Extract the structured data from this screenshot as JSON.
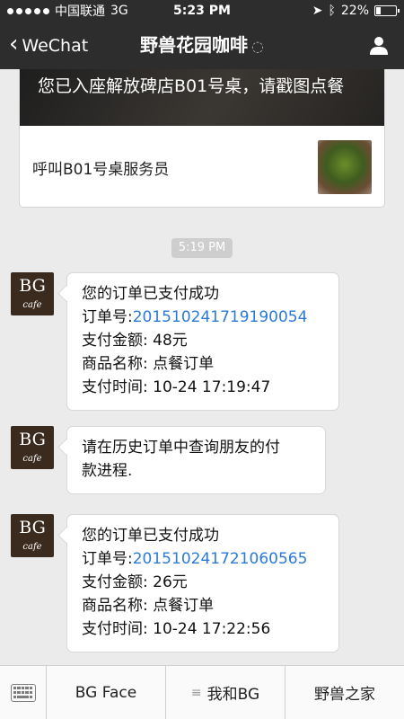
{
  "status_bar": {
    "carrier": "中国联通",
    "network": "3G",
    "time": "5:23 PM",
    "battery": "22%",
    "battery_level": 0.22
  },
  "nav": {
    "back_label": "WeChat",
    "title": "野兽花园咖啡"
  },
  "card": {
    "cover_text": "您已入座解放碑店B01号桌，请戳图点餐",
    "action_label": "呼叫B01号桌服务员"
  },
  "timestamp": "5:19 PM",
  "avatar": {
    "logo_top": "BG",
    "logo_bottom": "cafe"
  },
  "messages": [
    {
      "title": "您的订单已支付成功",
      "order_label": "订单号:",
      "order_no": "201510241719190054",
      "amount": "支付金额: 48元",
      "product": "商品名称: 点餐订单",
      "pay_time": "支付时间: 10-24 17:19:47"
    },
    {
      "line1": "请在历史订单中查询朋友的付",
      "line2": "款进程."
    },
    {
      "title": "您的订单已支付成功",
      "order_label": "订单号:",
      "order_no": "201510241721060565",
      "amount": "支付金额: 26元",
      "product": "商品名称: 点餐订单",
      "pay_time": "支付时间: 10-24 17:22:56"
    }
  ],
  "bottom_menu": [
    {
      "label": "BG Face"
    },
    {
      "label": "我和BG"
    },
    {
      "label": "野兽之家"
    }
  ],
  "colors": {
    "link": "#2a7ad8",
    "topbar": "#2d2d2d",
    "background": "#ebebeb"
  }
}
